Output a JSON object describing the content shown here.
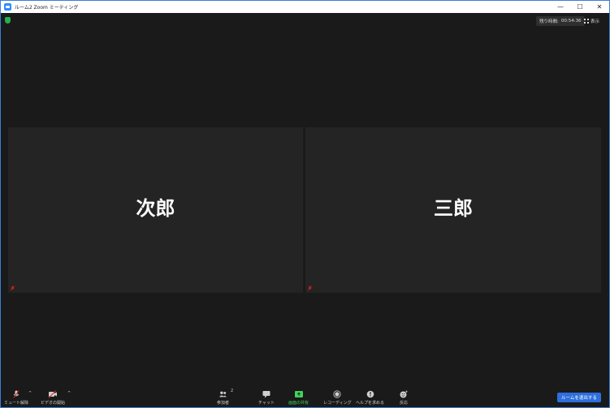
{
  "window": {
    "title": "ルーム2  Zoom ミーティング",
    "controls": {
      "minimize": "—",
      "maximize": "☐",
      "close": "✕"
    }
  },
  "header": {
    "timer_label": "残り時間:",
    "timer_value": "00:54:36",
    "view_label": "表示"
  },
  "participants": [
    {
      "name": "次郎"
    },
    {
      "name": "三郎"
    }
  ],
  "toolbar": {
    "mute_label": "ミュート解除",
    "video_label": "ビデオの開始",
    "participants_label": "参加者",
    "participants_count": "2",
    "chat_label": "チャット",
    "share_label": "画面の共有",
    "record_label": "レコーディング",
    "help_label": "ヘルプを求める",
    "reaction_label": "反応",
    "end_label": "ルームを退出する"
  },
  "colors": {
    "background": "#1a1a1a",
    "tile": "#242424",
    "accent": "#2d6fdc",
    "share_green": "#3fd35a",
    "muted_red": "#e02020",
    "shield_green": "#22b14c"
  }
}
